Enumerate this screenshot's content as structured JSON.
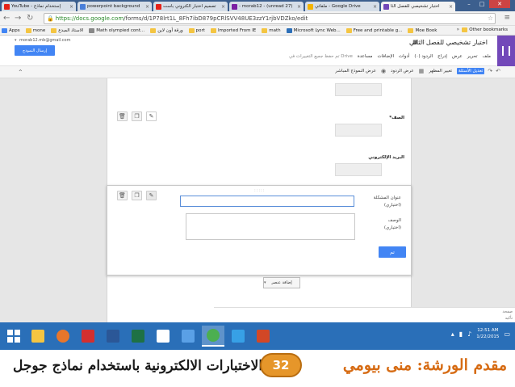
{
  "browser": {
    "tabs": [
      {
        "label": "إستخدام نماذج - YouTube",
        "favicon_color": "#e62117"
      },
      {
        "label": "powerpoint background",
        "favicon_color": "#4a7fd9"
      },
      {
        "label": "تصميم اختبار الكتروني باست",
        "favicon_color": "#e62117"
      },
      {
        "label": "(27 unread) - morab12 -",
        "favicon_color": "#7b1fa2"
      },
      {
        "label": "Google Drive - ملفاتي",
        "favicon_color": "#f4b400"
      },
      {
        "label": "اختبار تشخيصي للفصل الثا",
        "favicon_color": "#7248b9"
      }
    ],
    "url_host": "https://docs.google.com",
    "url_path": "/forms/d/1P78lrt1L_8Fh7ibD879pCRlSVV48UE3zzY1rjbVDZko/edit",
    "bookmarks": [
      {
        "label": "Apps",
        "color": "#4285f4"
      },
      {
        "label": "mone",
        "color": "#f4c542"
      },
      {
        "label": "الاستاذ المبدع",
        "color": "#f4c542"
      },
      {
        "label": "Math olympied cont...",
        "color": "#888888"
      },
      {
        "label": "ورقة أون لاين",
        "color": "#f4c542"
      },
      {
        "label": "port",
        "color": "#f4c542"
      },
      {
        "label": "Imported From IE",
        "color": "#f4c542"
      },
      {
        "label": "math",
        "color": "#f4c542"
      },
      {
        "label": "Microsoft Lync Web...",
        "color": "#2c6fb8"
      },
      {
        "label": "Free and printable g...",
        "color": "#f4c542"
      },
      {
        "label": "Moe Book",
        "color": "#f4c542"
      }
    ],
    "other_bookmarks": "Other bookmarks"
  },
  "docs": {
    "account": "morab12.mb@gmail.com",
    "send_form": "إرسال النموذج",
    "title": "اختبار تشخيصي للفصل الثاني",
    "menu": [
      "ملف",
      "تحرير",
      "عرض",
      "إدراج",
      "الردود (٠)",
      "أدوات",
      "الإضافات",
      "مساعدة"
    ],
    "saved_note": "تم حفظ جميع التغييرات في Drive",
    "toolbar": {
      "edit_questions": "تعديل الأسئلة",
      "change_theme": "تغيير المظهر",
      "view_responses": "عرض الردود",
      "view_live_form": "عرض النموذج المباشر"
    }
  },
  "form": {
    "q_class": "الصف*",
    "q_email": "البريد الإلكتروني",
    "editor": {
      "question_title_label": "عنوان المشكلة",
      "optional_1": "(اختياري)",
      "help_text_label": "الوصف",
      "optional_2": "(اختياري)",
      "done_button": "تم"
    },
    "add_item": "إضافة عنصر",
    "confirmation_title": "صفحة",
    "confirmation_sub": "تأكيد"
  },
  "taskbar": {
    "time": "12:51 AM",
    "date": "1/22/2015",
    "apps": [
      {
        "name": "file-explorer-icon",
        "color": "#f4c542"
      },
      {
        "name": "firefox-icon",
        "color": "#e8762b"
      },
      {
        "name": "acrobat-icon",
        "color": "#d32f2f"
      },
      {
        "name": "word-icon",
        "color": "#2b5797"
      },
      {
        "name": "excel-icon",
        "color": "#1e7145"
      },
      {
        "name": "onedrive-icon",
        "color": "#ffffff"
      },
      {
        "name": "store-icon",
        "color": "#5aa0e6"
      },
      {
        "name": "chrome-icon",
        "color": "#4caf50"
      },
      {
        "name": "internet-explorer-icon",
        "color": "#37a0e6"
      },
      {
        "name": "powerpoint-icon",
        "color": "#d24726"
      }
    ]
  },
  "slide": {
    "topic": "الاختبارات الالكترونية باستخدام نماذج جوجل",
    "page_number": "32",
    "presenter": "مقدم الورشة: منى بيومي"
  }
}
